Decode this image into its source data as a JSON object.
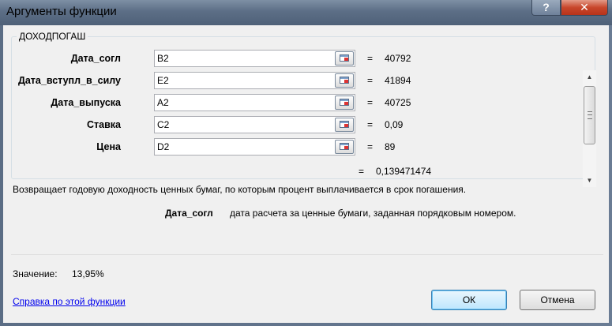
{
  "window": {
    "title": "Аргументы функции",
    "help_glyph": "?",
    "close_glyph": "✕"
  },
  "function": {
    "name": "ДОХОДПОГАШ"
  },
  "args": [
    {
      "label": "Дата_согл",
      "value": "B2",
      "result": "40792"
    },
    {
      "label": "Дата_вступл_в_силу",
      "value": "E2",
      "result": "41894"
    },
    {
      "label": "Дата_выпуска",
      "value": "A2",
      "result": "40725"
    },
    {
      "label": "Ставка",
      "value": "C2",
      "result": "0,09"
    },
    {
      "label": "Цена",
      "value": "D2",
      "result": "89"
    }
  ],
  "equals_sign": "=",
  "total_result": "0,139471474",
  "description": "Возвращает годовую доходность ценных бумаг, по которым процент выплачивается в срок погашения.",
  "arg_help": {
    "name": "Дата_согл",
    "text": "дата расчета за ценные бумаги, заданная порядковым номером."
  },
  "formula_value": {
    "label": "Значение:",
    "value": "13,95%"
  },
  "help_link": "Справка по этой функции",
  "buttons": {
    "ok": "ОК",
    "cancel": "Отмена"
  },
  "icons": {
    "ref_button": "collapse-dialog-icon",
    "scroll_up": "▲",
    "scroll_down": "▼"
  },
  "colors": {
    "link": "#0000ee",
    "ok_border": "#3c7fb1",
    "close": "#c8472c"
  }
}
